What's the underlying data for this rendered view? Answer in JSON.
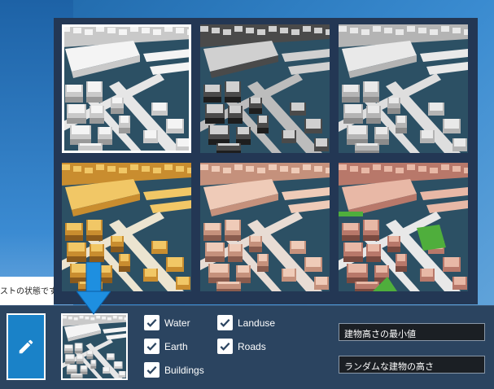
{
  "side_caption": "ストの状態です。",
  "layers": [
    {
      "label": "Water",
      "checked": true
    },
    {
      "label": "Landuse",
      "checked": true
    },
    {
      "label": "Earth",
      "checked": true
    },
    {
      "label": "Roads",
      "checked": true
    },
    {
      "label": "Buildings",
      "checked": true
    }
  ],
  "fields": {
    "min_height": "建物高さの最小値",
    "random_height": "ランダムな建物の高さ"
  },
  "styles": [
    {
      "id": "style-white",
      "selected": true
    },
    {
      "id": "style-gray-shadow",
      "selected": false
    },
    {
      "id": "style-light-gray",
      "selected": false
    },
    {
      "id": "style-yellow",
      "selected": false
    },
    {
      "id": "style-salmon",
      "selected": false
    },
    {
      "id": "style-colored",
      "selected": false
    }
  ],
  "colors": {
    "accent": "#1a82c8",
    "panel": "#233754",
    "bar": "#2b4460",
    "water": "#2a4a5c",
    "arrow": "#1e8fe0"
  },
  "icons": {
    "edit": "pencil-icon",
    "check": "checkmark-icon",
    "arrow": "arrow-down-icon"
  }
}
